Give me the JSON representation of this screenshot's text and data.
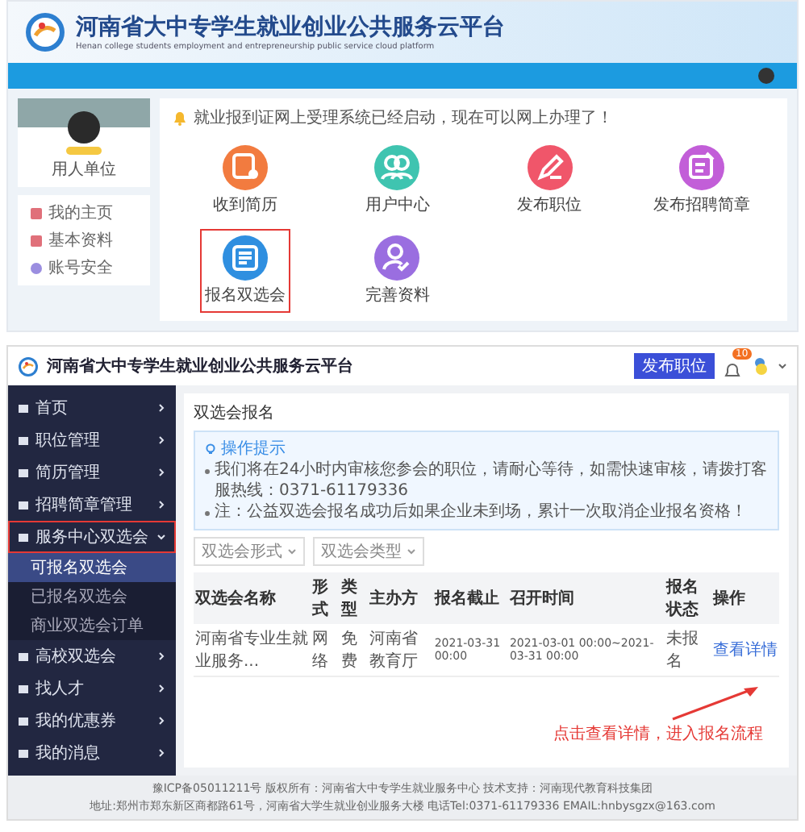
{
  "portal": {
    "title": "河南省大中专学生就业创业公共服务云平台",
    "subtitle": "Henan college students employment and entrepreneurship public service cloud platform",
    "profile": {
      "role": "用人单位"
    },
    "menu": [
      {
        "label": "我的主页"
      },
      {
        "label": "基本资料"
      },
      {
        "label": "账号安全"
      }
    ],
    "notice": "就业报到证网上受理系统已经启动，现在可以网上办理了！",
    "tiles": [
      {
        "label": "收到简历",
        "color": "#f27b3f",
        "highlighted": false
      },
      {
        "label": "用户中心",
        "color": "#3fc4b0",
        "highlighted": false
      },
      {
        "label": "发布职位",
        "color": "#f0566a",
        "highlighted": false
      },
      {
        "label": "发布招聘简章",
        "color": "#c25ed8",
        "highlighted": false
      },
      {
        "label": "报名双选会",
        "color": "#2f8fe0",
        "highlighted": true
      },
      {
        "label": "完善资料",
        "color": "#9a6ee0",
        "highlighted": false
      }
    ]
  },
  "console": {
    "title": "河南省大中专学生就业创业公共服务云平台",
    "publish_button": "发布职位",
    "badge": "10",
    "sidebar": [
      {
        "label": "首页",
        "selected": false,
        "expanded": false
      },
      {
        "label": "职位管理",
        "selected": false,
        "expanded": false
      },
      {
        "label": "简历管理",
        "selected": false,
        "expanded": false
      },
      {
        "label": "招聘简章管理",
        "selected": false,
        "expanded": false
      },
      {
        "label": "服务中心双选会",
        "selected": true,
        "expanded": true,
        "children": [
          {
            "label": "可报名双选会",
            "selected": true
          },
          {
            "label": "已报名双选会",
            "selected": false
          },
          {
            "label": "商业双选会订单",
            "selected": false
          }
        ]
      },
      {
        "label": "高校双选会",
        "selected": false,
        "expanded": false
      },
      {
        "label": "找人才",
        "selected": false,
        "expanded": false
      },
      {
        "label": "我的优惠券",
        "selected": false,
        "expanded": false
      },
      {
        "label": "我的消息",
        "selected": false,
        "expanded": false
      }
    ],
    "page_title": "双选会报名",
    "tips": {
      "heading": "操作提示",
      "items": [
        "我们将在24小时内审核您参会的职位，请耐心等待，如需快速审核，请拨打客服热线：0371-61179336",
        "注：公益双选会报名成功后如果企业未到场，累计一次取消企业报名资格！"
      ]
    },
    "filters": [
      {
        "placeholder": "双选会形式"
      },
      {
        "placeholder": "双选会类型"
      }
    ],
    "table": {
      "columns": [
        "双选会名称",
        "形式",
        "类型",
        "主办方",
        "报名截止",
        "召开时间",
        "报名状态",
        "操作"
      ],
      "rows": [
        [
          "河南省专业生就业服务...",
          "网络",
          "免费",
          "河南省教育厅",
          "2021-03-31 00:00",
          "2021-03-01 00:00~2021-03-31 00:00",
          "未报名",
          "查看详情"
        ]
      ]
    },
    "annotation": "点击查看详情，进入报名流程",
    "footer": [
      "豫ICP备05011211号 版权所有：河南省大中专学生就业服务中心 技术支持：河南现代教育科技集团",
      "地址:郑州市郑东新区商都路61号，河南省大学生就业创业服务大楼 电话Tel:0371-61179336 EMAIL:hnbysgzx@163.com"
    ]
  }
}
